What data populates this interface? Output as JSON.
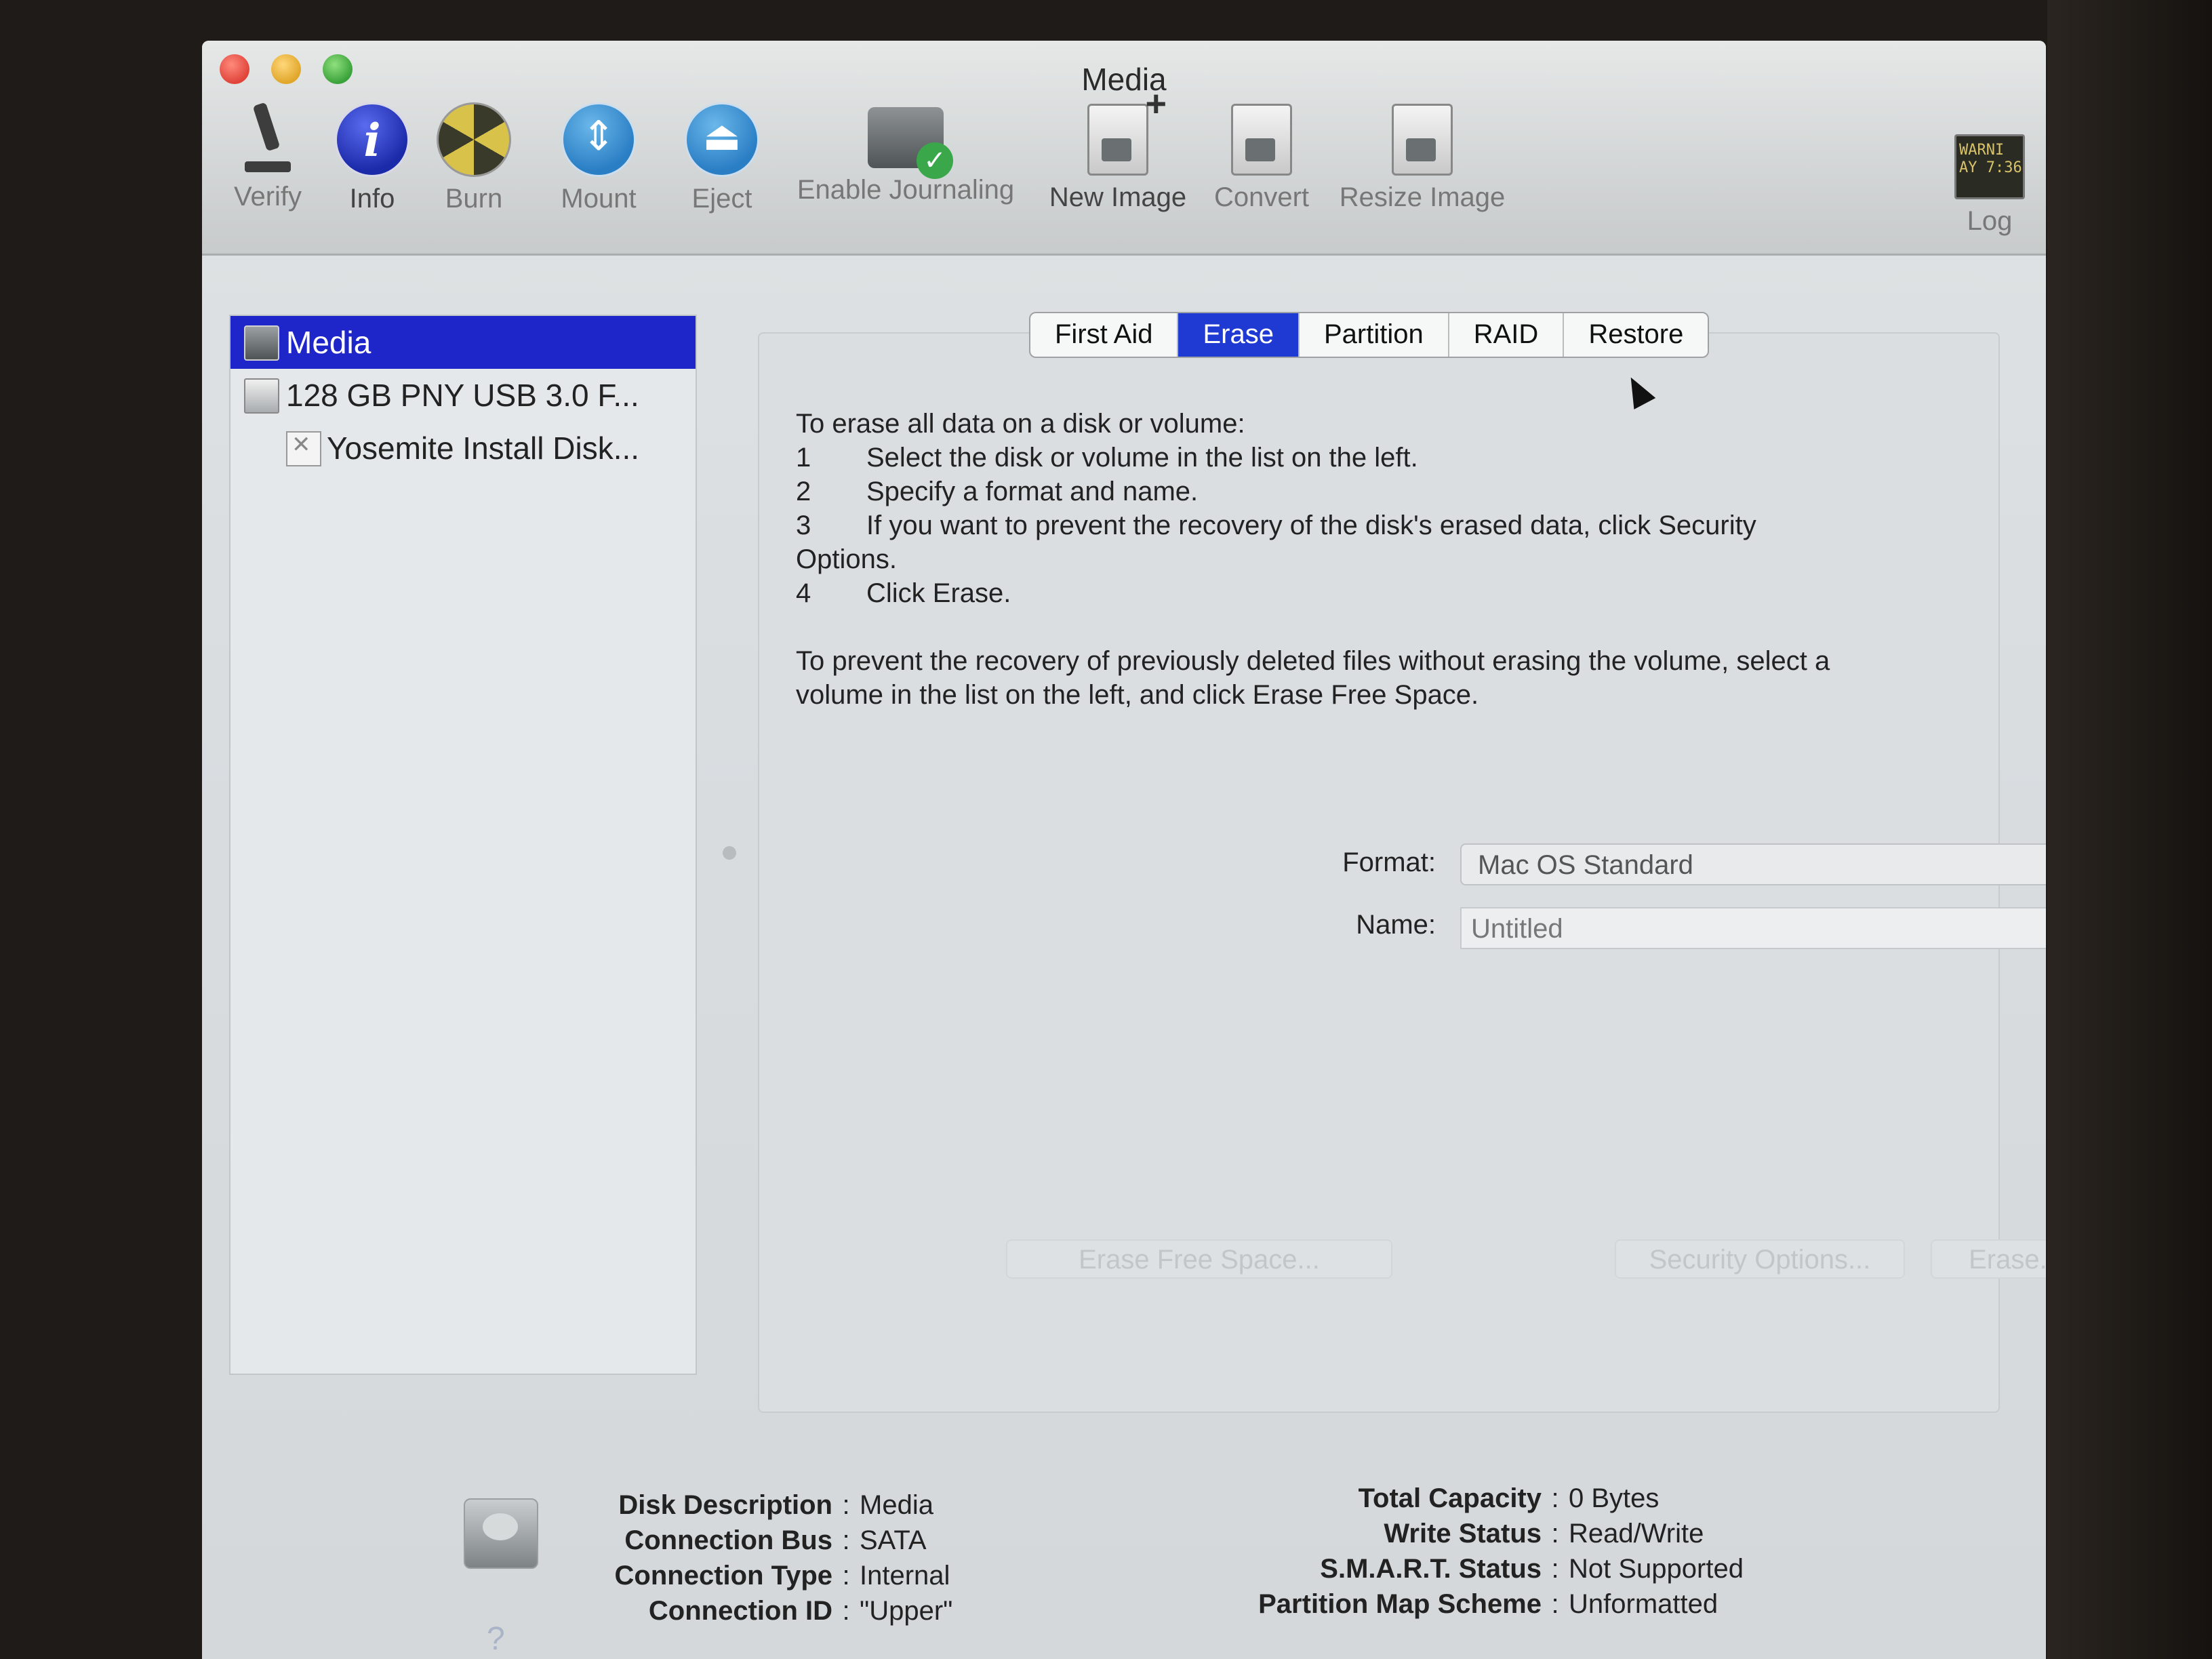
{
  "window": {
    "title": "Media"
  },
  "toolbar": {
    "items": [
      {
        "label": "Verify",
        "icon": "microscope-icon"
      },
      {
        "label": "Info",
        "icon": "info-icon",
        "glyph": "i"
      },
      {
        "label": "Burn",
        "icon": "burn-icon"
      },
      {
        "label": "Mount",
        "icon": "mount-icon",
        "glyph": "⇕"
      },
      {
        "label": "Eject",
        "icon": "eject-icon",
        "glyph": "⏏"
      },
      {
        "label": "Enable Journaling",
        "icon": "journaling-icon",
        "glyph": "✓"
      },
      {
        "label": "New Image",
        "icon": "new-image-icon"
      },
      {
        "label": "Convert",
        "icon": "convert-icon"
      },
      {
        "label": "Resize Image",
        "icon": "resize-image-icon"
      },
      {
        "label": "Log",
        "icon": "log-icon",
        "log_text": "WARNI\nAY 7:36"
      }
    ]
  },
  "sidebar": {
    "items": [
      {
        "label": "Media",
        "selected": true
      },
      {
        "label": "128 GB PNY USB 3.0 F..."
      },
      {
        "label": "Yosemite Install Disk..."
      }
    ]
  },
  "tabs": [
    {
      "label": "First Aid"
    },
    {
      "label": "Erase",
      "active": true
    },
    {
      "label": "Partition"
    },
    {
      "label": "RAID"
    },
    {
      "label": "Restore"
    }
  ],
  "instructions": {
    "intro": "To erase all data on a disk or volume:",
    "steps": [
      {
        "num": "1",
        "text": "Select the disk or volume in the list on the left."
      },
      {
        "num": "2",
        "text": "Specify a format and name."
      },
      {
        "num": "3",
        "text": "If you want to prevent the recovery of the disk's erased data, click Security"
      },
      {
        "num": "4",
        "text": "Click Erase."
      }
    ],
    "step3_cont": "Options.",
    "para2": "To prevent the recovery of previously deleted files without erasing the volume, select a volume in the list on the left, and click Erase Free Space."
  },
  "form": {
    "format_label": "Format:",
    "format_value": "Mac OS Standard",
    "name_label": "Name:",
    "name_value": "Untitled"
  },
  "buttons": {
    "erase_free_space": "Erase Free Space...",
    "security_options": "Security Options...",
    "erase": "Erase..."
  },
  "disk_info": {
    "left": [
      {
        "key": "Disk Description",
        "value": "Media"
      },
      {
        "key": "Connection Bus",
        "value": "SATA"
      },
      {
        "key": "Connection Type",
        "value": "Internal"
      },
      {
        "key": "Connection ID",
        "value": "\"Upper\""
      }
    ],
    "right": [
      {
        "key": "Total Capacity",
        "value": "0 Bytes"
      },
      {
        "key": "Write Status",
        "value": "Read/Write"
      },
      {
        "key": "S.M.A.R.T. Status",
        "value": "Not Supported"
      },
      {
        "key": "Partition Map Scheme",
        "value": "Unformatted"
      }
    ],
    "separator": ":"
  },
  "help": {
    "glyph": "?"
  },
  "colors": {
    "selection": "#1f26c9",
    "active_tab": "#1f3ad2"
  }
}
